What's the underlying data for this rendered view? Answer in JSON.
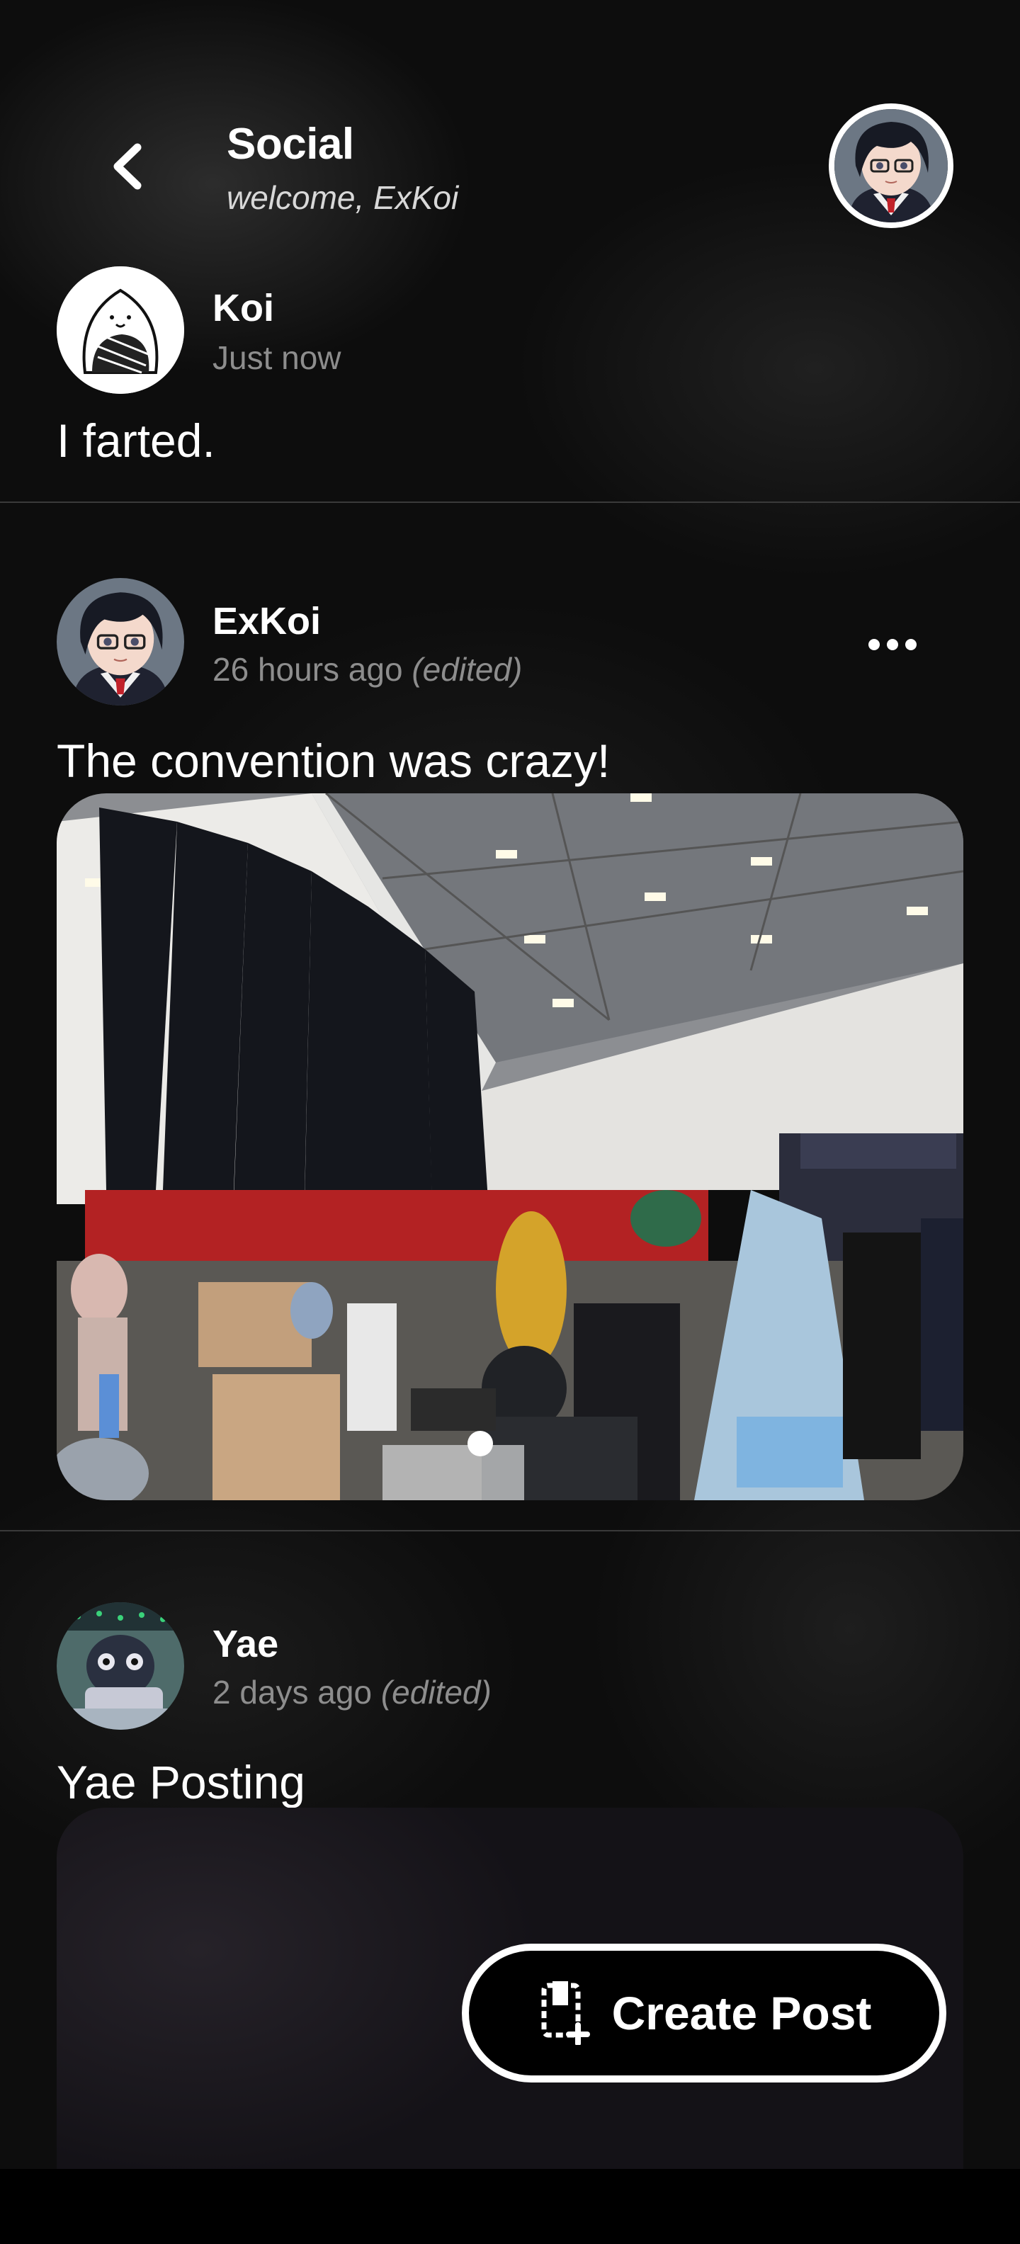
{
  "header": {
    "title": "Social",
    "subtitle": "welcome, ExKoi"
  },
  "posts": [
    {
      "author": "Koi",
      "time": "Just now",
      "edited": "",
      "text": "I farted."
    },
    {
      "author": "ExKoi",
      "time": "26 hours ago ",
      "edited": "(edited)",
      "text": "The convention was crazy!"
    },
    {
      "author": "Yae",
      "time": "2 days ago ",
      "edited": "(edited)",
      "text": "Yae Posting"
    }
  ],
  "create_post": {
    "label": "Create Post"
  },
  "colors": {
    "background": "#0d0d0d",
    "muted_text": "#8d8d8d",
    "divider": "#3a3a3a"
  },
  "icons": [
    "back-arrow-icon",
    "more-options-icon",
    "create-post-icon"
  ]
}
